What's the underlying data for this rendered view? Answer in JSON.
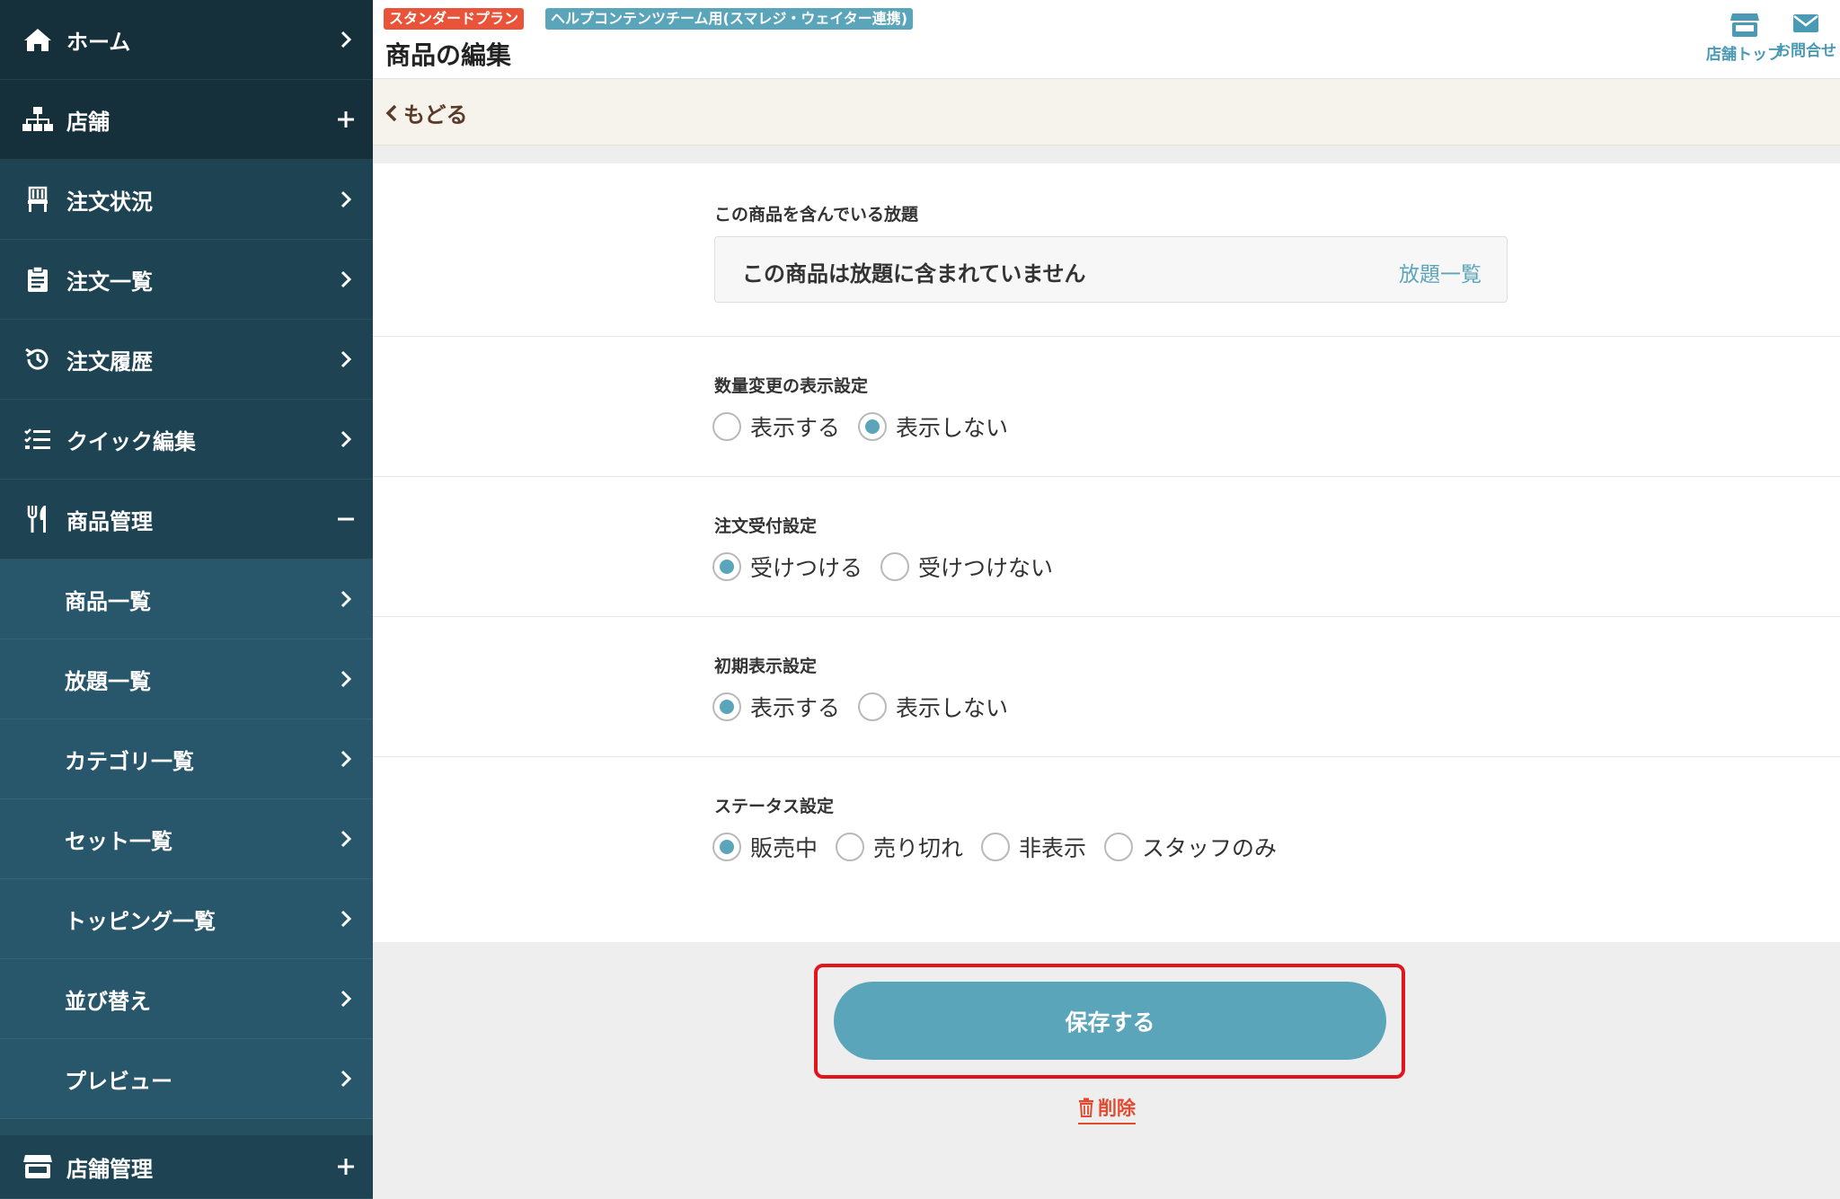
{
  "sidebar": {
    "items": [
      {
        "label": "ホーム",
        "icon": "home-icon",
        "action": "chevron"
      },
      {
        "label": "店舗",
        "icon": "sitemap-icon",
        "action": "plus"
      },
      {
        "label": "注文状況",
        "icon": "chair-icon",
        "action": "chevron"
      },
      {
        "label": "注文一覧",
        "icon": "clipboard-icon",
        "action": "chevron"
      },
      {
        "label": "注文履歴",
        "icon": "history-icon",
        "action": "chevron"
      },
      {
        "label": "クイック編集",
        "icon": "list-icon",
        "action": "chevron"
      },
      {
        "label": "商品管理",
        "icon": "utensils-icon",
        "action": "minus"
      }
    ],
    "sub_items": [
      {
        "label": "商品一覧"
      },
      {
        "label": "放題一覧"
      },
      {
        "label": "カテゴリ一覧"
      },
      {
        "label": "セット一覧"
      },
      {
        "label": "トッピング一覧"
      },
      {
        "label": "並び替え"
      },
      {
        "label": "プレビュー"
      }
    ],
    "bottom_item": {
      "label": "店舗管理",
      "icon": "store-icon",
      "action": "plus"
    }
  },
  "header": {
    "plan_badge": "スタンダードプラン",
    "team_badge": "ヘルプコンテンツチーム用(スマレジ・ウェイター連携)",
    "title": "商品の編集",
    "store_top": "店舗トップ",
    "contact": "お問合せ"
  },
  "back": {
    "label": "もどる"
  },
  "sections": {
    "houdai": {
      "label": "この商品を含んでいる放題",
      "message": "この商品は放題に含まれていません",
      "link": "放題一覧"
    },
    "quantity": {
      "label": "数量変更の表示設定",
      "options": [
        "表示する",
        "表示しない"
      ],
      "selected": 1
    },
    "order": {
      "label": "注文受付設定",
      "options": [
        "受けつける",
        "受けつけない"
      ],
      "selected": 0
    },
    "initial": {
      "label": "初期表示設定",
      "options": [
        "表示する",
        "表示しない"
      ],
      "selected": 0
    },
    "status": {
      "label": "ステータス設定",
      "options": [
        "販売中",
        "売り切れ",
        "非表示",
        "スタッフのみ"
      ],
      "selected": 0
    }
  },
  "footer": {
    "save_label": "保存する",
    "delete_label": "削除"
  },
  "colors": {
    "accent": "#5ba5bb",
    "sidebar": "#24505f",
    "danger": "#e24a2f",
    "highlight": "#e2141c"
  }
}
